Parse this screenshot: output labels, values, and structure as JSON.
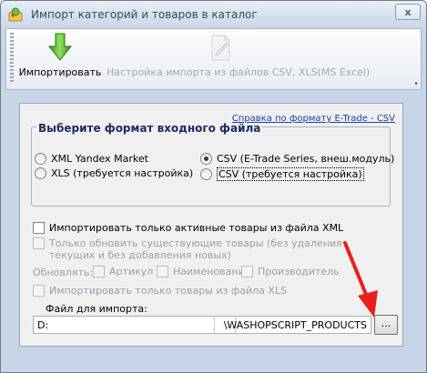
{
  "window": {
    "title": "Импорт категорий и товаров в каталог",
    "close_label": "x"
  },
  "toolbar": {
    "import_label": "Импортировать",
    "settings_label": "Настройка импорта из файлов CSV, XLS(MS Excel)",
    "overflow_label": "▾"
  },
  "format": {
    "title": "Выберите формат входного файла",
    "help_link": "Справка по формату E-Trade - CSV",
    "options": [
      {
        "label": "XML Yandex Market",
        "selected": false
      },
      {
        "label": "CSV (E-Trade Series, внеш.модуль)",
        "selected": true
      },
      {
        "label": "XLS (требуется настройка)",
        "selected": false
      },
      {
        "label": "CSV (требуется настройка)",
        "selected": false
      }
    ]
  },
  "options": {
    "active_only": "Импортировать только активные товары из файла XML",
    "update_existing_line1": "Только обновить существующие товары (без удаления",
    "update_existing_line2": "текущих и без добавления новых)",
    "update_label": "Обновлять:",
    "update_fields": [
      "Артикул",
      "Наименование",
      "Производитель"
    ],
    "xls_only": "Импортировать только товары из файла XLS"
  },
  "file": {
    "label": "Файл для импорта:",
    "path_start": "D:",
    "path_end": "\\WASHOPSCRIPT_PRODUCTS",
    "browse_label": "..."
  },
  "colors": {
    "arrow": "#e8201c",
    "link": "#1a3fa8",
    "frame": "#c6d6e8"
  }
}
